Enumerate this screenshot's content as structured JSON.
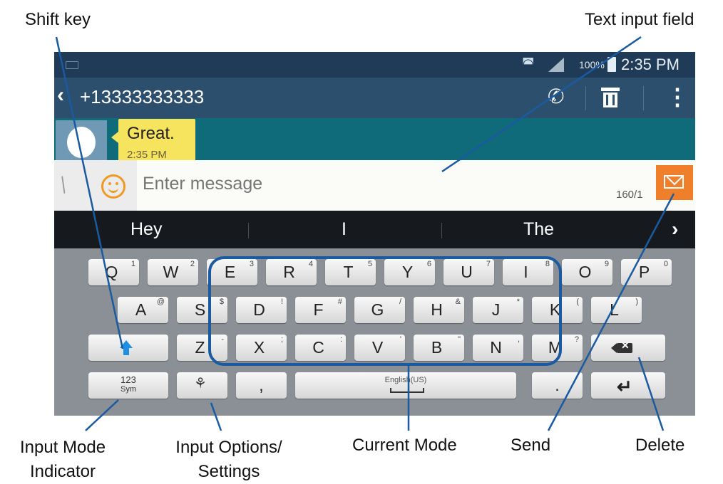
{
  "callouts": {
    "shift_key": "Shift key",
    "text_input_field": "Text input field",
    "input_mode_line1": "Input Mode",
    "input_mode_line2": "Indicator",
    "input_options_line1": "Input Options/",
    "input_options_line2": "Settings",
    "current_mode": "Current Mode",
    "send": "Send",
    "delete": "Delete"
  },
  "status_bar": {
    "battery": "100%",
    "time": "2:35 PM"
  },
  "action_bar": {
    "contact": "+13333333333"
  },
  "conversation": {
    "message": "Great.",
    "timestamp": "2:35 PM"
  },
  "compose": {
    "placeholder": "Enter message",
    "counter": "160/1"
  },
  "suggestions": [
    "Hey",
    "I",
    "The"
  ],
  "keyboard": {
    "row1": [
      {
        "key": "Q",
        "sup": "1"
      },
      {
        "key": "W",
        "sup": "2"
      },
      {
        "key": "E",
        "sup": "3"
      },
      {
        "key": "R",
        "sup": "4"
      },
      {
        "key": "T",
        "sup": "5"
      },
      {
        "key": "Y",
        "sup": "6"
      },
      {
        "key": "U",
        "sup": "7"
      },
      {
        "key": "I",
        "sup": "8"
      },
      {
        "key": "O",
        "sup": "9"
      },
      {
        "key": "P",
        "sup": "0"
      }
    ],
    "row2": [
      {
        "key": "A",
        "sup": "@"
      },
      {
        "key": "S",
        "sup": "$"
      },
      {
        "key": "D",
        "sup": "!"
      },
      {
        "key": "F",
        "sup": "#"
      },
      {
        "key": "G",
        "sup": "/"
      },
      {
        "key": "H",
        "sup": "&"
      },
      {
        "key": "J",
        "sup": "*"
      },
      {
        "key": "K",
        "sup": "("
      },
      {
        "key": "L",
        "sup": ")"
      }
    ],
    "row3": [
      {
        "key": "Z",
        "sup": "-"
      },
      {
        "key": "X",
        "sup": ";"
      },
      {
        "key": "C",
        "sup": ":"
      },
      {
        "key": "V",
        "sup": "'"
      },
      {
        "key": "B",
        "sup": "\""
      },
      {
        "key": "N",
        "sup": ","
      },
      {
        "key": "M",
        "sup": "?"
      }
    ],
    "sym_top": "123",
    "sym_bottom": "Sym",
    "comma": ",",
    "period": ".",
    "space_language": "English(US)"
  },
  "icons": {
    "back": "chevron-left-icon",
    "call": "phone-icon",
    "delete_thread": "trash-icon",
    "menu": "more-vertical-icon",
    "attach": "paperclip-icon",
    "emoticon": "smiley-icon",
    "send": "send-message-icon",
    "shift": "shift-arrow-icon",
    "mic": "microphone-settings-icon",
    "backspace": "backspace-icon",
    "enter": "enter-icon"
  },
  "colors": {
    "status_bar": "#1f3b57",
    "action_bar": "#2c4f6e",
    "conversation_bg": "#0f6a7a",
    "bubble": "#f6e45f",
    "send_button": "#f07f2c",
    "callout_lines": "#1a5aa0",
    "shift_accent": "#1e8fe1"
  }
}
